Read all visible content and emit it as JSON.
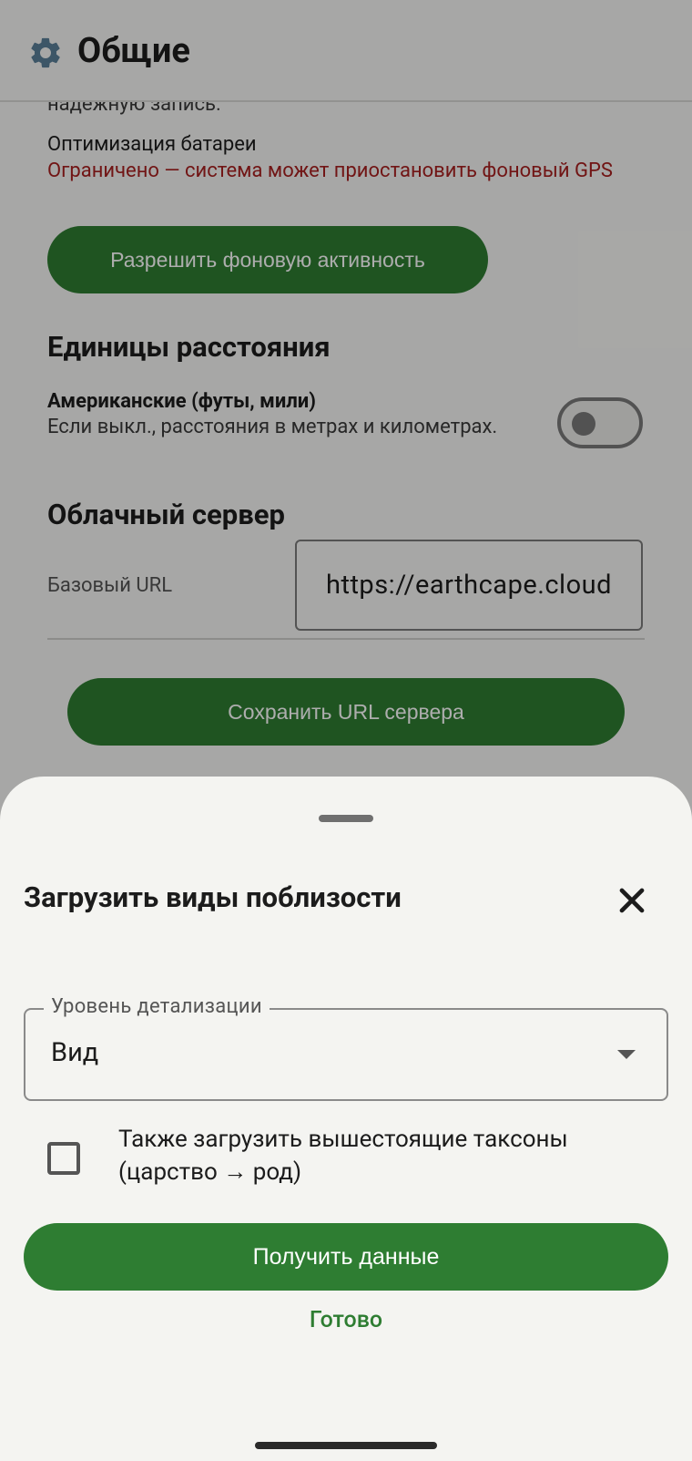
{
  "app_bar": {
    "title": "Общие",
    "icon": "gear-icon"
  },
  "battery": {
    "top_note": "надежную запись.",
    "label": "Оптимизация батареи",
    "warning": "Ограничено — система может приостановить фоновый GPS",
    "allow_button": "Разрешить фоновую активность"
  },
  "units": {
    "title": "Единицы расстояния",
    "option_title": "Американские (футы, мили)",
    "option_desc": "Если выкл., расстояния в метрах и километрах.",
    "toggle_on": false
  },
  "cloud": {
    "title": "Облачный сервер",
    "url_label": "Базовый URL",
    "url_value": "https://earthcape.cloud",
    "save_button": "Сохранить URL сервера"
  },
  "sheet": {
    "title": "Загрузить виды поблизости",
    "detail_label": "Уровень детализации",
    "detail_value": "Вид",
    "checkbox_label": "Также загрузить вышестоящие таксоны (царство → род)",
    "checkbox_checked": false,
    "fetch_button": "Получить данные",
    "done_button": "Готово"
  },
  "colors": {
    "accent": "#2e7d32",
    "warning": "#a7201f"
  }
}
